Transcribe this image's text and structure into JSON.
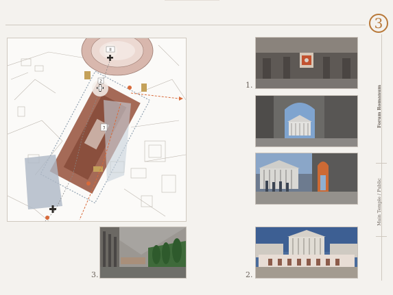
{
  "section": {
    "number": "3",
    "title": "Forum Romanum",
    "subtitle": "Main Temple / Public"
  },
  "photos": [
    {
      "label": "1.",
      "icon": "rotunda-interior"
    },
    {
      "label": "",
      "icon": "arch-view-temple"
    },
    {
      "label": "",
      "icon": "temple-with-figures"
    },
    {
      "label": "2.",
      "icon": "temple-facade-colonnade"
    },
    {
      "label": "3.",
      "icon": "colonnade-street"
    }
  ],
  "map": {
    "markers": [
      "II",
      "2",
      "3"
    ]
  },
  "colors": {
    "accent": "#b87838",
    "temple": "#9b5a45",
    "path": "#d86a3a"
  }
}
